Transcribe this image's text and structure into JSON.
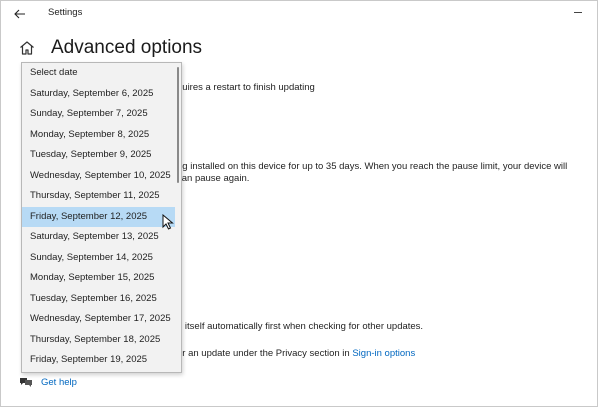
{
  "window": {
    "title": "Settings"
  },
  "page": {
    "title": "Advanced options"
  },
  "background_text": {
    "restart_notice": "quires a restart to finish updating",
    "pause_line1": "ng installed on this device for up to 35 days. When you reach the pause limit, your device will",
    "pause_line2": "can pause again.",
    "auto_update": "e itself automatically first when checking for other updates.",
    "privacy_prefix": "er an update under the Privacy section in",
    "signin_link": "Sign-in options"
  },
  "get_help": {
    "label": "Get help"
  },
  "date_dropdown": {
    "items": [
      "Select date",
      "Saturday, September 6, 2025",
      "Sunday, September 7, 2025",
      "Monday, September 8, 2025",
      "Tuesday, September 9, 2025",
      "Wednesday, September 10, 2025",
      "Thursday, September 11, 2025",
      "Friday, September 12, 2025",
      "Saturday, September 13, 2025",
      "Sunday, September 14, 2025",
      "Monday, September 15, 2025",
      "Tuesday, September 16, 2025",
      "Wednesday, September 17, 2025",
      "Thursday, September 18, 2025",
      "Friday, September 19, 2025"
    ],
    "highlighted_index": 7
  },
  "colors": {
    "accent": "#0067c0",
    "highlight": "#b7daf5"
  },
  "icons": [
    "back-arrow-icon",
    "minimize-icon",
    "home-icon",
    "get-help-icon",
    "mouse-cursor-icon"
  ]
}
